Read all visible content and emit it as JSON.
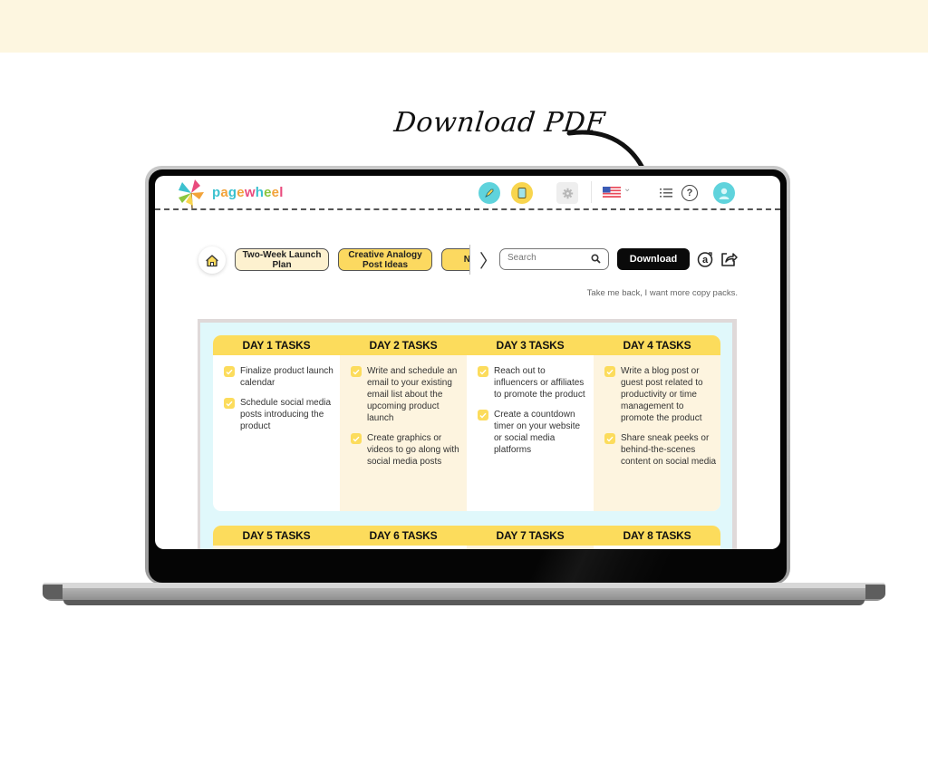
{
  "annotation": {
    "text": "Download PDF"
  },
  "app": {
    "brand": {
      "letters": [
        "p",
        "a",
        "g",
        "e",
        "w",
        "h",
        "e",
        "e",
        "l"
      ],
      "colors": [
        "#3cc1cf",
        "#f2a33a",
        "#3cc1cf",
        "#f2a33a",
        "#e94b7d",
        "#3cc1cf",
        "#8cc63f",
        "#f2a33a",
        "#e94b7d"
      ]
    },
    "header": {
      "icons": [
        "rocket-icon",
        "document-icon",
        "gear-icon",
        "us-flag-icon",
        "chevron-down-icon",
        "list-icon",
        "help-icon",
        "user-avatar-icon"
      ],
      "help_glyph": "?",
      "chevron_glyph": "⌄"
    },
    "toolbar": {
      "tabs": [
        {
          "label": "Two-Week Launch Plan",
          "active": true
        },
        {
          "label": "Creative Analogy Post Ideas",
          "active": false
        },
        {
          "label": "N",
          "active": false
        }
      ],
      "next_glyph": "〉",
      "search": {
        "placeholder": "Search",
        "value": ""
      },
      "download_label": "Download",
      "back_link": "Take me back, I want more copy packs."
    },
    "colors": {
      "accent_yellow": "#fcdc5c",
      "alt_column": "#fdf4df",
      "sheet_bg": "#e0f8fb",
      "teal": "#5fd3dc"
    }
  },
  "plan": {
    "weeks": [
      {
        "days": [
          {
            "title": "DAY 1 TASKS",
            "tasks": [
              "Finalize product launch calendar",
              "Schedule social media posts introducing the product"
            ]
          },
          {
            "title": "DAY 2 TASKS",
            "tasks": [
              "Write and schedule an email to your existing email list about the upcoming product launch",
              "Create graphics or videos to go along with social media posts"
            ]
          },
          {
            "title": "DAY 3 TASKS",
            "tasks": [
              "Reach out to influencers or affiliates to promote the product",
              "Create a countdown timer on your website or social media platforms"
            ]
          },
          {
            "title": "DAY 4 TASKS",
            "tasks": [
              "Write a blog post or guest post related to productivity or time management to promote the product",
              "Share sneak peeks or behind-the-scenes content on social media"
            ]
          }
        ]
      },
      {
        "days": [
          {
            "title": "DAY 5 TASKS",
            "tasks": []
          },
          {
            "title": "DAY 6 TASKS",
            "tasks": []
          },
          {
            "title": "DAY 7 TASKS",
            "tasks": []
          },
          {
            "title": "DAY 8 TASKS",
            "tasks": []
          }
        ]
      }
    ]
  }
}
